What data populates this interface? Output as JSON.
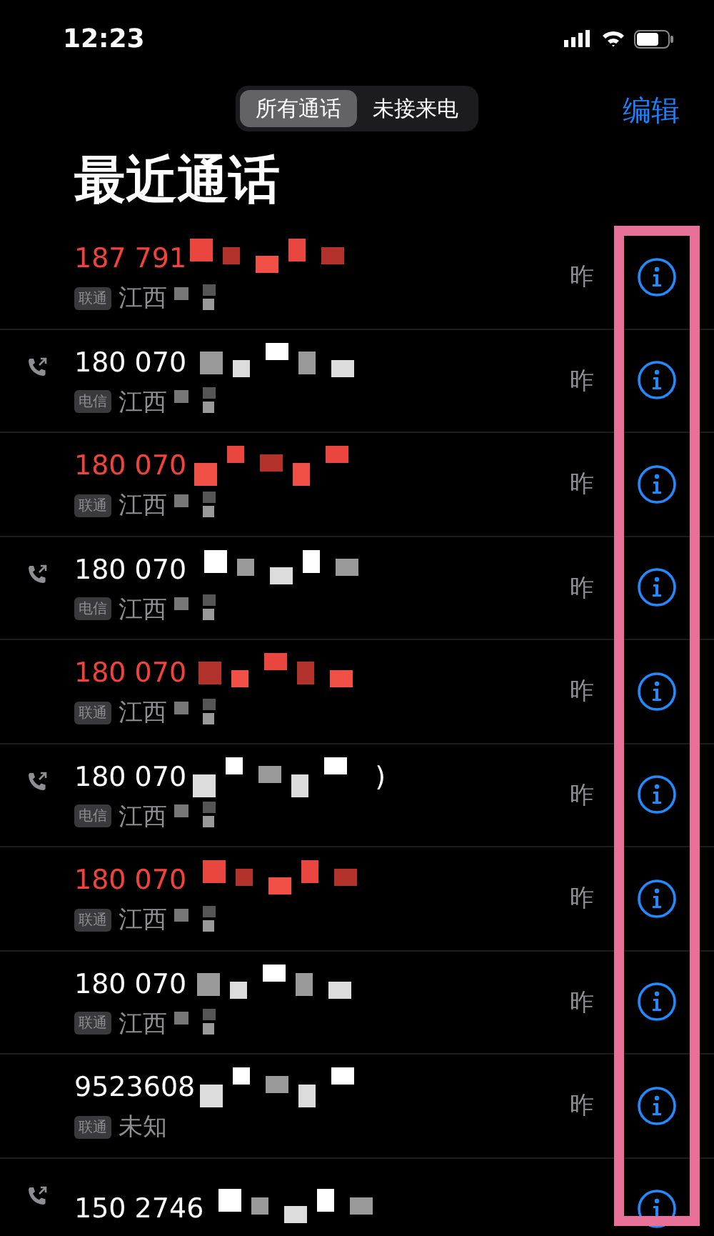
{
  "status_bar": {
    "time": "12:23"
  },
  "segments": [
    {
      "label": "所有通话",
      "selected": true
    },
    {
      "label": "未接来电",
      "selected": false
    }
  ],
  "edit_label": "编辑",
  "title": "最近通话",
  "calls": [
    {
      "number": "187 791",
      "missed": true,
      "outgoing": false,
      "carrier": "联通",
      "location": "江西",
      "time": "昨"
    },
    {
      "number": "180 070",
      "missed": false,
      "outgoing": true,
      "carrier": "电信",
      "location": "江西",
      "time": "昨"
    },
    {
      "number": "180 070",
      "missed": true,
      "outgoing": false,
      "carrier": "联通",
      "location": "江西",
      "time": "昨"
    },
    {
      "number": "180 070",
      "missed": false,
      "outgoing": true,
      "carrier": "电信",
      "location": "江西",
      "time": "昨"
    },
    {
      "number": "180 070",
      "missed": true,
      "outgoing": false,
      "carrier": "联通",
      "location": "江西",
      "time": "昨"
    },
    {
      "number": "180 070",
      "suffix": ")",
      "missed": false,
      "outgoing": true,
      "carrier": "电信",
      "location": "江西",
      "time": "昨"
    },
    {
      "number": "180 070",
      "missed": true,
      "outgoing": false,
      "carrier": "联通",
      "location": "江西",
      "time": "昨"
    },
    {
      "number": "180 070",
      "missed": false,
      "outgoing": false,
      "carrier": "联通",
      "location": "江西",
      "time": "昨"
    },
    {
      "number": "9523608",
      "missed": false,
      "outgoing": false,
      "carrier": "联通",
      "location": "未知",
      "time": "昨",
      "plain": true
    },
    {
      "number": "150 2746",
      "missed": false,
      "outgoing": true
    }
  ]
}
